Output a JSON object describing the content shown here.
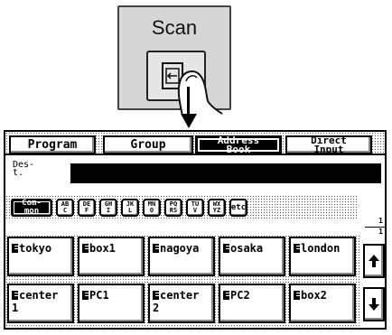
{
  "scan_key": {
    "label": "Scan",
    "icon": "scan-arrow-icon"
  },
  "tabs": [
    {
      "label": "Program",
      "active": false
    },
    {
      "label": "Group",
      "active": false
    },
    {
      "label_line1": "Address",
      "label_line2": "Book",
      "active": true
    },
    {
      "label_line1": "Direct",
      "label_line2": "Input",
      "active": false
    }
  ],
  "destination": {
    "label_line1": "Des-",
    "label_line2": "t.",
    "value": ""
  },
  "index_keys": [
    {
      "line1": "Com-",
      "line2": "mon",
      "selected": true
    },
    {
      "line1": "AB",
      "line2": "C"
    },
    {
      "line1": "DE",
      "line2": "F"
    },
    {
      "line1": "GH",
      "line2": "I"
    },
    {
      "line1": "JK",
      "line2": "L"
    },
    {
      "line1": "MN",
      "line2": "O"
    },
    {
      "line1": "PQ",
      "line2": "RS"
    },
    {
      "line1": "TU",
      "line2": "V"
    },
    {
      "line1": "WX",
      "line2": "YZ"
    },
    {
      "line1": "etc",
      "line2": ""
    }
  ],
  "page": {
    "current": "1",
    "total": "1"
  },
  "destinations": [
    {
      "line1": "tokyo",
      "line2": ""
    },
    {
      "line1": "box1",
      "line2": ""
    },
    {
      "line1": "nagoya",
      "line2": ""
    },
    {
      "line1": "osaka",
      "line2": ""
    },
    {
      "line1": "london",
      "line2": ""
    },
    {
      "line1": "center",
      "line2": "1"
    },
    {
      "line1": "PC1",
      "line2": ""
    },
    {
      "line1": "center",
      "line2": "2"
    },
    {
      "line1": "PC2",
      "line2": ""
    },
    {
      "line1": "box2",
      "line2": ""
    }
  ],
  "scroll": {
    "up_icon": "arrow-up-icon",
    "down_icon": "arrow-down-icon"
  }
}
